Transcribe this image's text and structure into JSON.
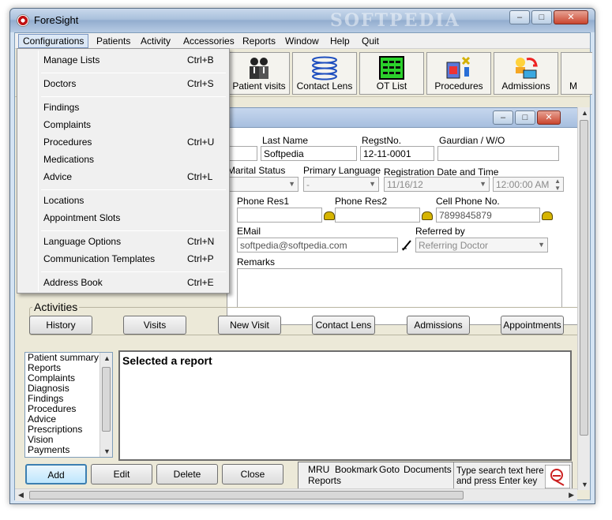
{
  "window": {
    "title": "ForeSight",
    "watermark": "SOFTPEDIA",
    "controls": {
      "minimize": "–",
      "maximize": "□",
      "close": "✕"
    }
  },
  "menubar": {
    "items": [
      "Configurations",
      "Patients",
      "Activity",
      "Accessories",
      "Reports",
      "Window",
      "Help",
      "Quit"
    ]
  },
  "toolbar": {
    "buttons": [
      "Patient visits",
      "Contact Lens",
      "OT List",
      "Procedures",
      "Admissions",
      "M"
    ]
  },
  "configurations_menu": {
    "items": [
      {
        "label": "Manage Lists",
        "shortcut": "Ctrl+B"
      },
      {
        "label": "Doctors",
        "shortcut": "Ctrl+S"
      },
      {
        "label": "Findings",
        "shortcut": ""
      },
      {
        "label": "Complaints",
        "shortcut": ""
      },
      {
        "label": "Procedures",
        "shortcut": "Ctrl+U"
      },
      {
        "label": "Medications",
        "shortcut": ""
      },
      {
        "label": "Advice",
        "shortcut": "Ctrl+L"
      },
      {
        "label": "Locations",
        "shortcut": ""
      },
      {
        "label": "Appointment Slots",
        "shortcut": ""
      },
      {
        "label": "Language Options",
        "shortcut": "Ctrl+N"
      },
      {
        "label": "Communication Templates",
        "shortcut": "Ctrl+P"
      },
      {
        "label": "Address Book",
        "shortcut": "Ctrl+E"
      }
    ]
  },
  "patient_form": {
    "labels": {
      "last_name": "Last Name",
      "regst_no": "RegstNo.",
      "guardian": "Gaurdian / W/O",
      "marital_status": "Marital Status",
      "primary_language": "Primary Language",
      "registration_datetime": "Registration Date and Time",
      "phone_res1": "Phone Res1",
      "phone_res2": "Phone Res2",
      "cell_phone": "Cell Phone No.",
      "email": "EMail",
      "referred_by": "Referred by",
      "remarks": "Remarks"
    },
    "values": {
      "last_name": "Softpedia",
      "regst_no": "12-11-0001",
      "guardian": "",
      "marital_status": "",
      "primary_language": "-",
      "registration_date": "11/16/12",
      "registration_time": "12:00:00 AM",
      "phone_res1": "",
      "phone_res2": "",
      "cell_phone": "7899845879",
      "email": "softpedia@softpedia.com",
      "referred_by": "Referring Doctor",
      "remarks": ""
    }
  },
  "activities": {
    "heading": "Activities",
    "buttons": [
      "History",
      "Visits",
      "New Visit",
      "Contact Lens",
      "Admissions",
      "Appointments"
    ]
  },
  "report_list": {
    "items": [
      "Patient summary",
      "Reports",
      "Complaints",
      "Diagnosis",
      "Findings",
      "Procedures",
      "Advice",
      "Prescriptions",
      "Vision",
      "Payments"
    ]
  },
  "report_view": {
    "title": "Selected a report"
  },
  "bottom_buttons": [
    "Add",
    "Edit",
    "Delete",
    "Close"
  ],
  "nav_panel": {
    "links": [
      "MRU",
      "Bookmark",
      "Goto",
      "Documents",
      "Reports"
    ],
    "search_hint_line1": "Type search text here",
    "search_hint_line2": "and press Enter key"
  }
}
